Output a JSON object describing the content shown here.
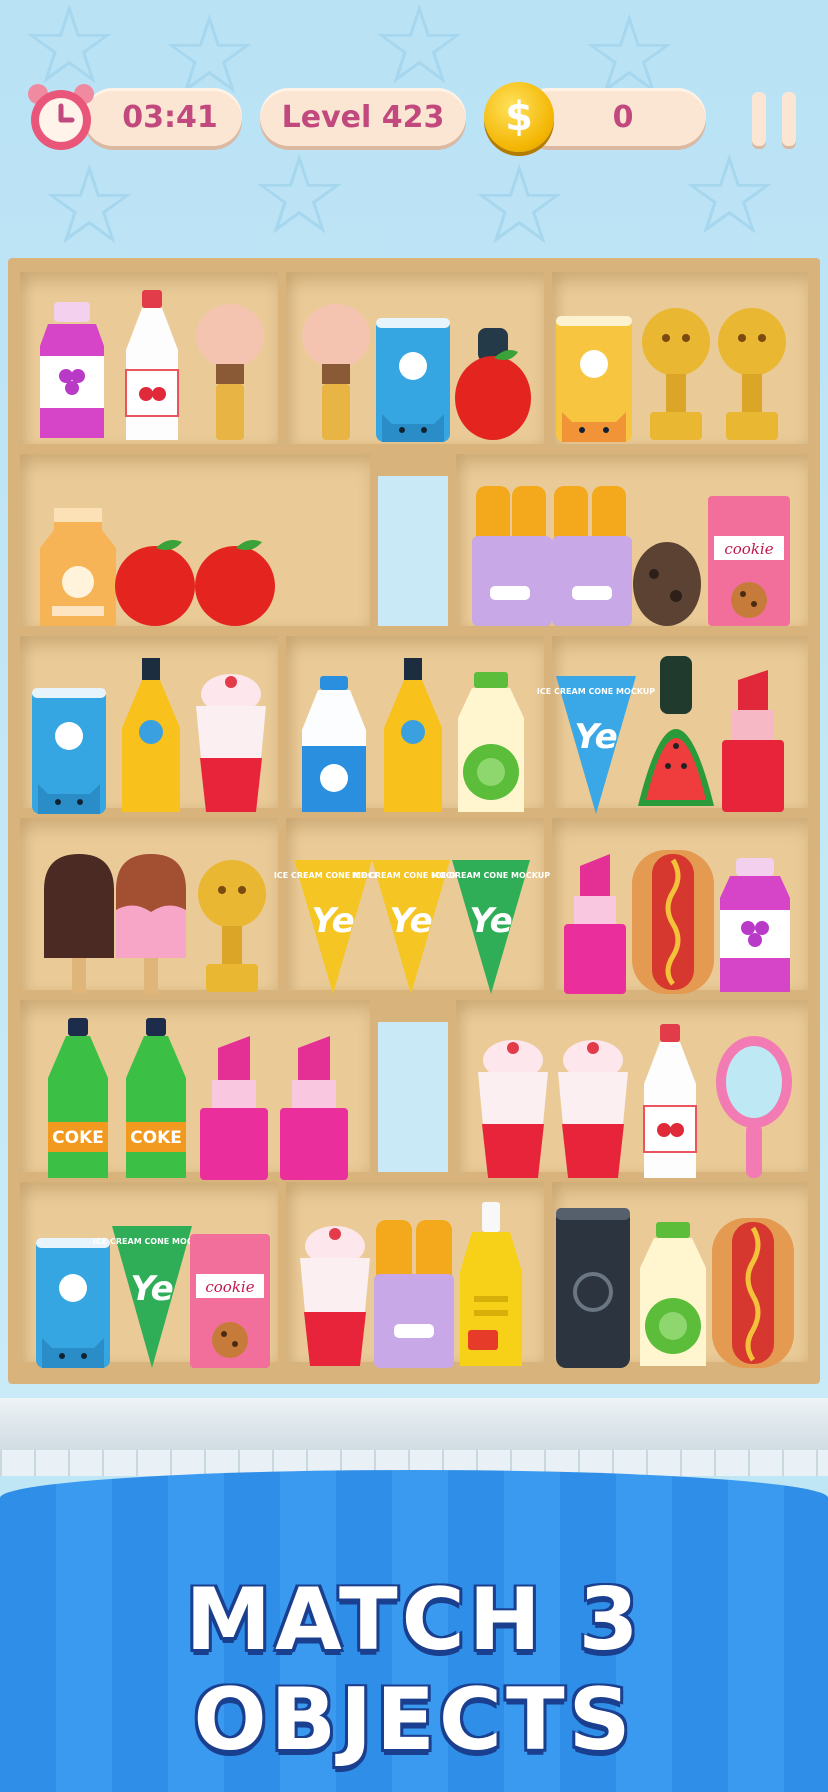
{
  "hud": {
    "timer": "03:41",
    "level": "Level 423",
    "coins": "0",
    "coin_symbol": "$"
  },
  "banner": {
    "title": "MATCH 3 OBJECTS"
  },
  "labels": {
    "ice_cream_cone": "ICE CREAM CONE MOCKUP",
    "ye": "Ye",
    "coke": "COKE",
    "cookie": "cookie"
  },
  "shelf_rows": [
    {
      "row": 1,
      "items": [
        "grape-milk-bottle",
        "cherry-milk-bottle",
        "makeup-brush",
        "makeup-brush",
        "blue-cat-cup",
        "apple",
        "yellow-cat-cup",
        "trophy",
        "trophy"
      ]
    },
    {
      "row": 2,
      "items": [
        "milk-carton",
        "apple",
        "apple",
        "fries-box",
        "fries-box",
        "cookie-box"
      ]
    },
    {
      "row": 3,
      "items": [
        "blue-cat-cup",
        "orange-juice-bottle",
        "strawberry-milkshake",
        "blue-milk-bottle",
        "orange-juice-bottle",
        "green-yogurt-bottle",
        "blue-ice-cream-cone",
        "watermelon-slice",
        "red-lipstick"
      ]
    },
    {
      "row": 4,
      "items": [
        "chocolate-popsicle",
        "strawberry-popsicle",
        "trophy",
        "yellow-ice-cream-cone",
        "yellow-ice-cream-cone",
        "green-ice-cream-cone",
        "pink-lipstick",
        "hot-dog",
        "grape-milk-bottle"
      ]
    },
    {
      "row": 5,
      "items": [
        "coke-bottle",
        "coke-bottle",
        "pink-lipstick",
        "pink-lipstick",
        "strawberry-milkshake",
        "strawberry-milkshake",
        "cherry-milk-bottle",
        "hand-mirror"
      ]
    },
    {
      "row": 6,
      "items": [
        "blue-cat-cup",
        "green-ice-cream-cone",
        "cookie-box",
        "strawberry-milkshake",
        "fries-box",
        "yellow-ketchup-bottle",
        "dark-can",
        "green-yogurt-bottle",
        "hot-dog"
      ]
    }
  ],
  "colors": {
    "pill": "#fbe6d4",
    "pill_text": "#c2497d",
    "wood": "#eacb97",
    "banner_blue": "#3a9af0"
  }
}
